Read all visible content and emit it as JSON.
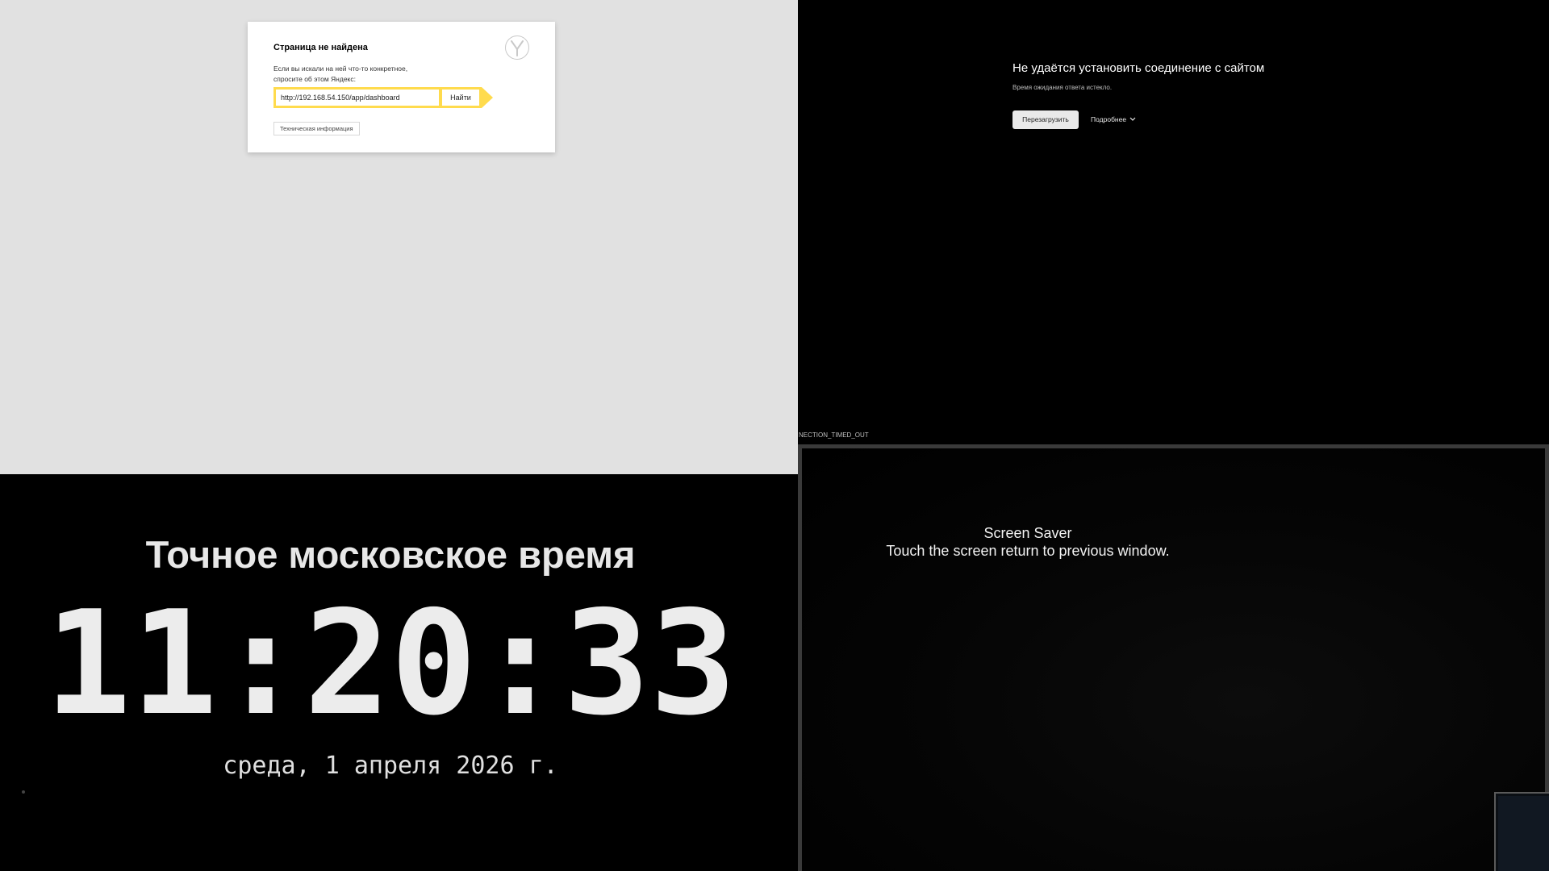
{
  "yandex_error": {
    "title": "Страница не найдена",
    "description": "Если вы искали на ней что-то конкретное, спросите об этом Яндекс:",
    "search_value": "http://192.168.54.150/app/dashboard",
    "find_label": "Найти",
    "tech_info_label": "Техническая информация",
    "logo_icon": "yandex-y-logo-icon",
    "accent_color": "#ffdb4d"
  },
  "connection_error": {
    "title": "Не удаётся установить соединение с сайтом",
    "subtitle": "Время ожидания ответа истекло.",
    "reload_label": "Перезагрузить",
    "more_label": "Подробнее",
    "more_icon": "chevron-down-icon",
    "error_code": "NECTION_TIMED_OUT"
  },
  "clock": {
    "title": "Точное московское время",
    "time": "11:20:33",
    "date": "среда, 1 апреля 2026 г."
  },
  "screen_saver": {
    "title": "Screen Saver",
    "message": "Touch the screen return to previous window."
  }
}
